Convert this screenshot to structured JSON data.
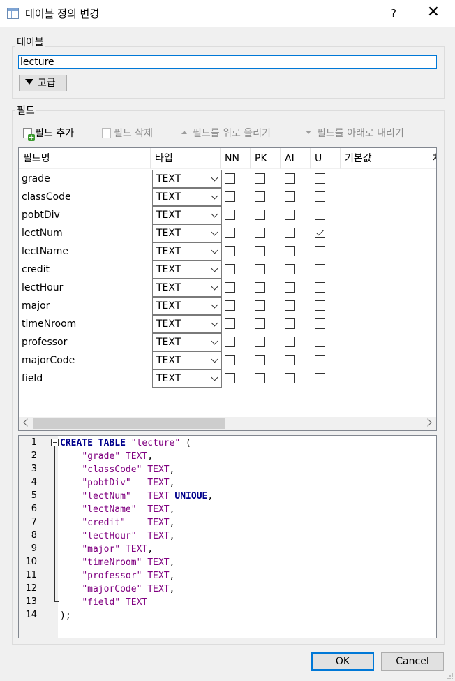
{
  "window": {
    "title": "테이블 정의 변경",
    "help_label": "?",
    "close_label": "✕"
  },
  "table_group": {
    "label": "테이블",
    "name_value": "lecture",
    "advanced_label": "고급"
  },
  "fields_group": {
    "label": "필드",
    "toolbar": {
      "add_label": "필드 추가",
      "delete_label": "필드 삭제",
      "move_up_label": "필드를 위로 올리기",
      "move_down_label": "필드를 아래로 내리기"
    },
    "columns": [
      "필드명",
      "타입",
      "NN",
      "PK",
      "AI",
      "U",
      "기본값",
      "체"
    ],
    "rows": [
      {
        "name": "grade",
        "type": "TEXT",
        "nn": false,
        "pk": false,
        "ai": false,
        "u": false
      },
      {
        "name": "classCode",
        "type": "TEXT",
        "nn": false,
        "pk": false,
        "ai": false,
        "u": false
      },
      {
        "name": "pobtDiv",
        "type": "TEXT",
        "nn": false,
        "pk": false,
        "ai": false,
        "u": false
      },
      {
        "name": "lectNum",
        "type": "TEXT",
        "nn": false,
        "pk": false,
        "ai": false,
        "u": true
      },
      {
        "name": "lectName",
        "type": "TEXT",
        "nn": false,
        "pk": false,
        "ai": false,
        "u": false
      },
      {
        "name": "credit",
        "type": "TEXT",
        "nn": false,
        "pk": false,
        "ai": false,
        "u": false
      },
      {
        "name": "lectHour",
        "type": "TEXT",
        "nn": false,
        "pk": false,
        "ai": false,
        "u": false
      },
      {
        "name": "major",
        "type": "TEXT",
        "nn": false,
        "pk": false,
        "ai": false,
        "u": false
      },
      {
        "name": "timeNroom",
        "type": "TEXT",
        "nn": false,
        "pk": false,
        "ai": false,
        "u": false
      },
      {
        "name": "professor",
        "type": "TEXT",
        "nn": false,
        "pk": false,
        "ai": false,
        "u": false
      },
      {
        "name": "majorCode",
        "type": "TEXT",
        "nn": false,
        "pk": false,
        "ai": false,
        "u": false
      },
      {
        "name": "field",
        "type": "TEXT",
        "nn": false,
        "pk": false,
        "ai": false,
        "u": false
      }
    ]
  },
  "sql_preview": {
    "lines": [
      [
        [
          "kw",
          "CREATE"
        ],
        [
          "pl",
          " "
        ],
        [
          "kw",
          "TABLE"
        ],
        [
          "pl",
          " "
        ],
        [
          "str",
          "\"lecture\""
        ],
        [
          "pl",
          " ("
        ]
      ],
      [
        [
          "pl",
          "    "
        ],
        [
          "str",
          "\"grade\""
        ],
        [
          "pl",
          " "
        ],
        [
          "typ",
          "TEXT"
        ],
        [
          "pl",
          ","
        ]
      ],
      [
        [
          "pl",
          "    "
        ],
        [
          "str",
          "\"classCode\""
        ],
        [
          "pl",
          " "
        ],
        [
          "typ",
          "TEXT"
        ],
        [
          "pl",
          ","
        ]
      ],
      [
        [
          "pl",
          "    "
        ],
        [
          "str",
          "\"pobtDiv\""
        ],
        [
          "pl",
          "   "
        ],
        [
          "typ",
          "TEXT"
        ],
        [
          "pl",
          ","
        ]
      ],
      [
        [
          "pl",
          "    "
        ],
        [
          "str",
          "\"lectNum\""
        ],
        [
          "pl",
          "   "
        ],
        [
          "typ",
          "TEXT"
        ],
        [
          "pl",
          " "
        ],
        [
          "kw",
          "UNIQUE"
        ],
        [
          "pl",
          ","
        ]
      ],
      [
        [
          "pl",
          "    "
        ],
        [
          "str",
          "\"lectName\""
        ],
        [
          "pl",
          "  "
        ],
        [
          "typ",
          "TEXT"
        ],
        [
          "pl",
          ","
        ]
      ],
      [
        [
          "pl",
          "    "
        ],
        [
          "str",
          "\"credit\""
        ],
        [
          "pl",
          "    "
        ],
        [
          "typ",
          "TEXT"
        ],
        [
          "pl",
          ","
        ]
      ],
      [
        [
          "pl",
          "    "
        ],
        [
          "str",
          "\"lectHour\""
        ],
        [
          "pl",
          "  "
        ],
        [
          "typ",
          "TEXT"
        ],
        [
          "pl",
          ","
        ]
      ],
      [
        [
          "pl",
          "    "
        ],
        [
          "str",
          "\"major\""
        ],
        [
          "pl",
          " "
        ],
        [
          "typ",
          "TEXT"
        ],
        [
          "pl",
          ","
        ]
      ],
      [
        [
          "pl",
          "    "
        ],
        [
          "str",
          "\"timeNroom\""
        ],
        [
          "pl",
          " "
        ],
        [
          "typ",
          "TEXT"
        ],
        [
          "pl",
          ","
        ]
      ],
      [
        [
          "pl",
          "    "
        ],
        [
          "str",
          "\"professor\""
        ],
        [
          "pl",
          " "
        ],
        [
          "typ",
          "TEXT"
        ],
        [
          "pl",
          ","
        ]
      ],
      [
        [
          "pl",
          "    "
        ],
        [
          "str",
          "\"majorCode\""
        ],
        [
          "pl",
          " "
        ],
        [
          "typ",
          "TEXT"
        ],
        [
          "pl",
          ","
        ]
      ],
      [
        [
          "pl",
          "    "
        ],
        [
          "str",
          "\"field\""
        ],
        [
          "pl",
          " "
        ],
        [
          "typ",
          "TEXT"
        ]
      ],
      [
        [
          "pl",
          ");"
        ]
      ]
    ]
  },
  "buttons": {
    "ok_label": "OK",
    "cancel_label": "Cancel"
  },
  "colors": {
    "accent": "#0078d7",
    "keyword": "#00008b",
    "string": "#800080"
  }
}
